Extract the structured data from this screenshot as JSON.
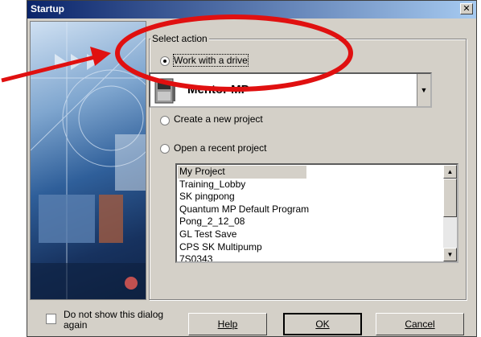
{
  "window": {
    "title": "Startup",
    "close_label": "✕"
  },
  "group": {
    "legend": "Select action"
  },
  "options": {
    "drive": {
      "label": "Work with a drive",
      "checked": true
    },
    "new_project": {
      "label": "Create a new project",
      "checked": false
    },
    "recent_project": {
      "label": "Open a recent project",
      "checked": false
    }
  },
  "drive_combo": {
    "value": "Mentor MP"
  },
  "recent_projects": [
    "My Project",
    "Training_Lobby",
    "SK pingpong",
    "Quantum MP Default Program",
    "Pong_2_12_08",
    "GL Test Save",
    "CPS SK Multipump",
    "7S0343"
  ],
  "footer": {
    "dont_show_line1": "Do not show this dialog",
    "dont_show_line2": "again",
    "help_label": "Help",
    "ok_label": "OK",
    "cancel_label": "Cancel"
  },
  "annotation": {
    "ellipse_color": "#e01010",
    "arrow_color": "#e01010"
  }
}
